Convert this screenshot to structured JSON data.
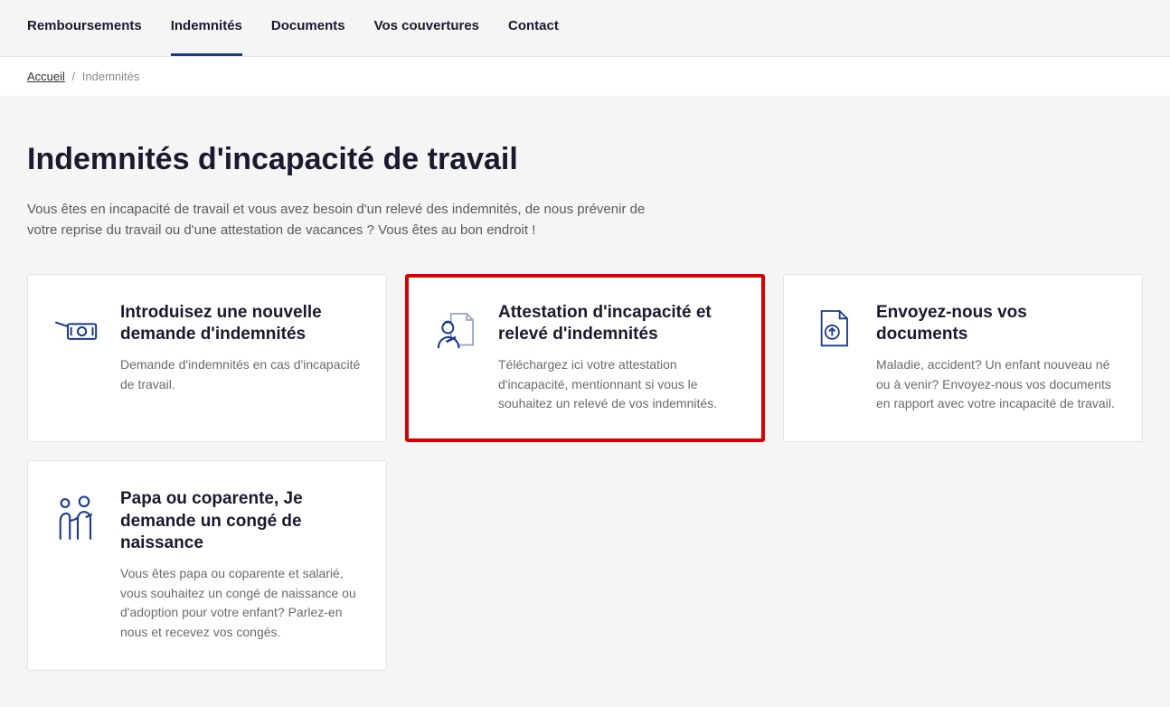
{
  "nav": {
    "items": [
      {
        "label": "Remboursements"
      },
      {
        "label": "Indemnités"
      },
      {
        "label": "Documents"
      },
      {
        "label": "Vos couvertures"
      },
      {
        "label": "Contact"
      }
    ]
  },
  "breadcrumb": {
    "home": "Accueil",
    "sep": "/",
    "current": "Indemnités"
  },
  "page": {
    "title": "Indemnités d'incapacité de travail",
    "intro": "Vous êtes en incapacité de travail et vous avez besoin d'un relevé des indemnités, de nous prévenir de votre reprise du travail ou d'une attestation de vacances ? Vous êtes au bon endroit !"
  },
  "cards": [
    {
      "title": "Introduisez une nouvelle demande d'indemnités",
      "desc": "Demande d'indemnités en cas d'incapacité de travail.",
      "icon": "money-hand-icon"
    },
    {
      "title": "Attestation d'incapacité et relevé d'indemnités",
      "desc": "Téléchargez ici votre attestation d'incapacité, mentionnant si vous le souhaitez un relevé de vos indemnités.",
      "icon": "person-doc-icon"
    },
    {
      "title": "Envoyez-nous vos documents",
      "desc": "Maladie, accident? Un enfant nouveau né ou à venir?  Envoyez-nous vos documents en rapport avec votre incapacité de travail.",
      "icon": "upload-doc-icon"
    },
    {
      "title": "Papa ou coparente, Je demande un congé de naissance",
      "desc": "Vous êtes papa ou coparente et salarié, vous souhaitez un congé de naissance ou d'adoption pour votre enfant? Parlez-en nous et recevez vos congés.",
      "icon": "parent-child-icon"
    }
  ]
}
